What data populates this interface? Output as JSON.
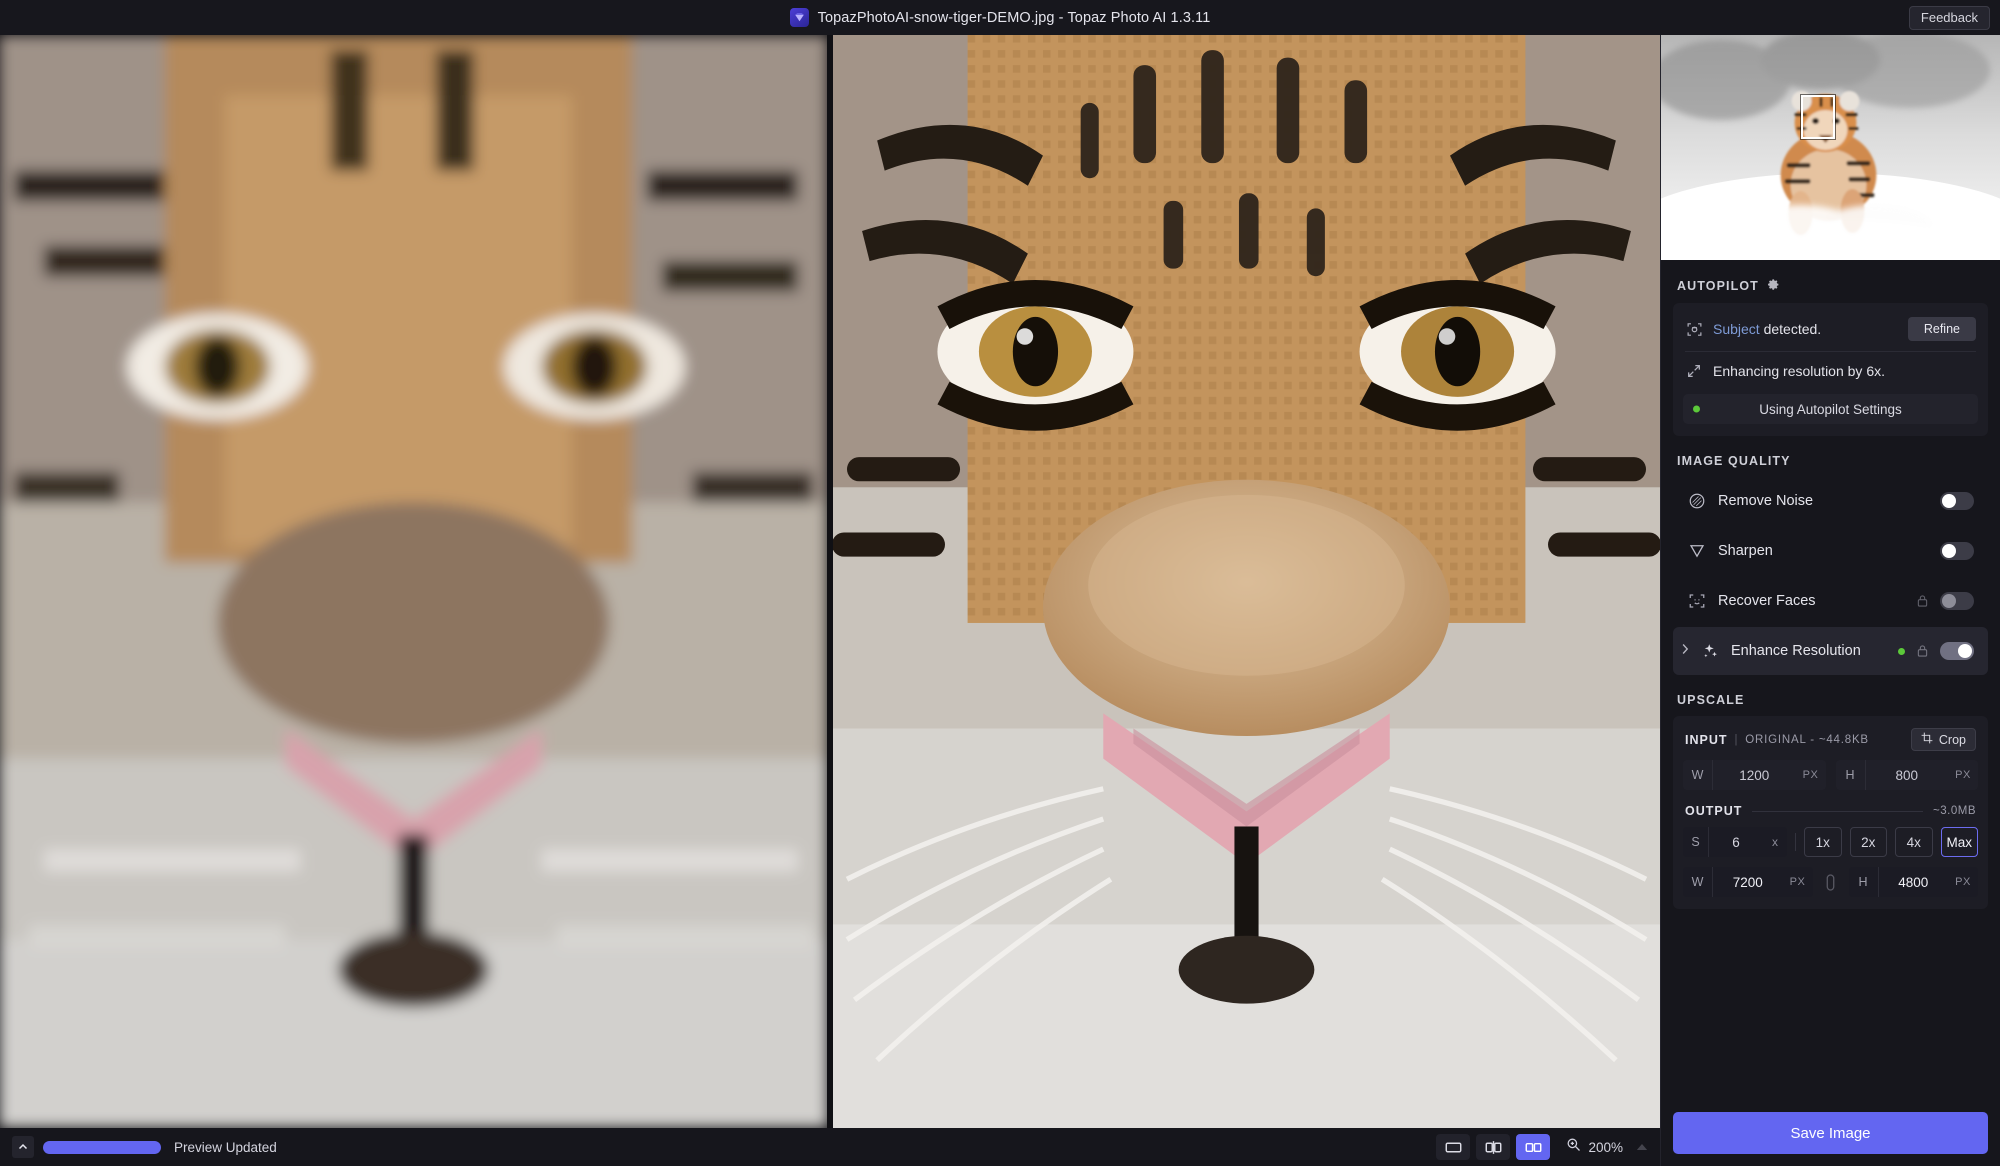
{
  "window": {
    "title": "TopazPhotoAI-snow-tiger-DEMO.jpg - Topaz Photo AI 1.3.11",
    "logo_icon": "topaz-diamond-icon",
    "feedback_label": "Feedback"
  },
  "viewer": {
    "left_pane_name": "original-image-pane",
    "right_pane_name": "enhanced-image-pane",
    "subject": "tiger-face"
  },
  "navigator": {
    "name": "navigator-thumbnail",
    "subject": "tiger-running-in-snow",
    "crop_box_label": "viewport-indicator"
  },
  "autopilot": {
    "title": "AUTOPILOT",
    "gear_icon": "gear-icon",
    "subject_icon": "subject-detect-icon",
    "subject_link": "Subject",
    "subject_rest": " detected.",
    "refine_label": "Refine",
    "resolution_icon": "resize-arrows-icon",
    "resolution_text": "Enhancing resolution by 6x.",
    "settings_label": "Using Autopilot Settings",
    "status_dot_color": "#5cc93a"
  },
  "image_quality": {
    "title": "IMAGE QUALITY",
    "rows": [
      {
        "label": "Remove Noise",
        "icon": "noise-circle-icon",
        "toggle": "off",
        "locked": false,
        "dot": false,
        "expandable": false,
        "active": false
      },
      {
        "label": "Sharpen",
        "icon": "sharpen-triangle-icon",
        "toggle": "off",
        "locked": false,
        "dot": false,
        "expandable": false,
        "active": false
      },
      {
        "label": "Recover Faces",
        "icon": "face-detect-icon",
        "toggle": "off-dim",
        "locked": true,
        "dot": false,
        "expandable": false,
        "active": false
      },
      {
        "label": "Enhance Resolution",
        "icon": "sparkles-icon",
        "toggle": "on",
        "locked": true,
        "dot": true,
        "expandable": true,
        "active": true
      }
    ]
  },
  "upscale": {
    "title": "UPSCALE",
    "input": {
      "label": "INPUT",
      "separator": "|",
      "meta": "ORIGINAL - ~44.8KB",
      "crop_label": "Crop",
      "crop_icon": "crop-icon",
      "width_key": "W",
      "width_value": "1200",
      "width_unit": "PX",
      "height_key": "H",
      "height_value": "800",
      "height_unit": "PX"
    },
    "output": {
      "label": "OUTPUT",
      "size": "~3.0MB",
      "scale_key": "S",
      "scale_value": "6",
      "scale_unit": "x",
      "multipliers": [
        {
          "label": "1x",
          "selected": false
        },
        {
          "label": "2x",
          "selected": false
        },
        {
          "label": "4x",
          "selected": false
        },
        {
          "label": "Max",
          "selected": true
        }
      ],
      "width_key": "W",
      "width_value": "7200",
      "width_unit": "PX",
      "height_key": "H",
      "height_value": "4800",
      "height_unit": "PX",
      "link_icon": "link-chain-icon"
    }
  },
  "footer": {
    "save_label": "Save Image"
  },
  "statusbar": {
    "collapse_icon": "chevron-up-icon",
    "progress_percent": 100,
    "status_text": "Preview Updated",
    "view_modes": [
      {
        "icon": "single-view-icon",
        "name": "view-mode-single",
        "selected": false
      },
      {
        "icon": "split-view-icon",
        "name": "view-mode-split",
        "selected": false
      },
      {
        "icon": "side-by-side-icon",
        "name": "view-mode-side-by-side",
        "selected": true
      }
    ],
    "zoom_icon": "magnifier-icon",
    "zoom_value": "200%",
    "zoom_caret": "caret-up-icon"
  },
  "colors": {
    "accent": "#6366f1",
    "panel_bg": "#16161c",
    "card_bg": "#1d1d25",
    "green": "#5cc93a",
    "link_blue": "#7e9bd6"
  }
}
